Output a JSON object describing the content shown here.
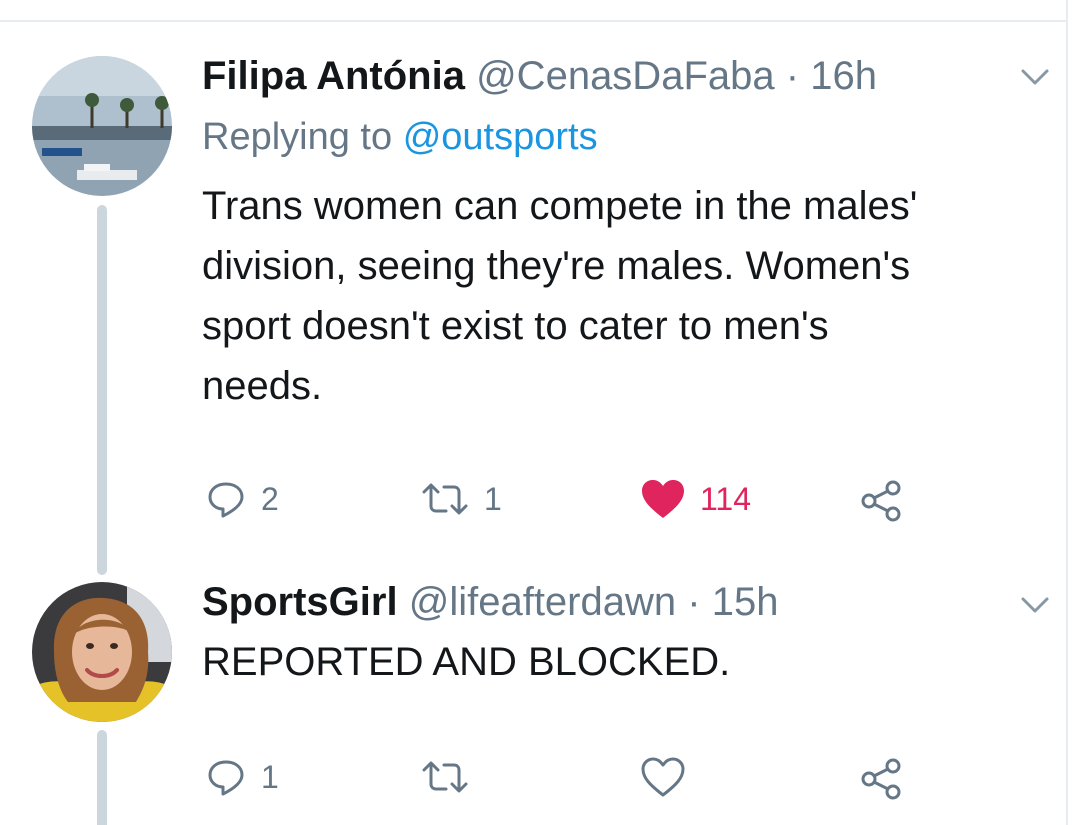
{
  "tweets": [
    {
      "name": "Filipa Antónia",
      "handle": "@CenasDaFaba",
      "separator": "·",
      "time": "16h",
      "replying_prefix": "Replying to",
      "replying_to": "@outsports",
      "text_lines": [
        "Trans women can compete in the males'",
        "division, seeing they're males. Women's",
        "sport doesn't exist to cater to men's",
        "needs."
      ],
      "actions": {
        "reply_count": "2",
        "retweet_count": "1",
        "like_count": "114",
        "liked": true
      }
    },
    {
      "name": "SportsGirl",
      "handle": "@lifeafterdawn",
      "separator": "·",
      "time": "15h",
      "text_lines": [
        "REPORTED AND BLOCKED."
      ],
      "actions": {
        "reply_count": "1",
        "retweet_count": "",
        "like_count": "",
        "liked": false
      }
    }
  ],
  "colors": {
    "primary_text": "#14171a",
    "secondary_text": "#657786",
    "link": "#1b95e0",
    "like": "#e0245e",
    "thread_line": "#ccd6dd"
  },
  "icons": {
    "caret": "chevron-down-icon",
    "reply": "reply-icon",
    "retweet": "retweet-icon",
    "like": "heart-icon",
    "share": "share-icon"
  }
}
